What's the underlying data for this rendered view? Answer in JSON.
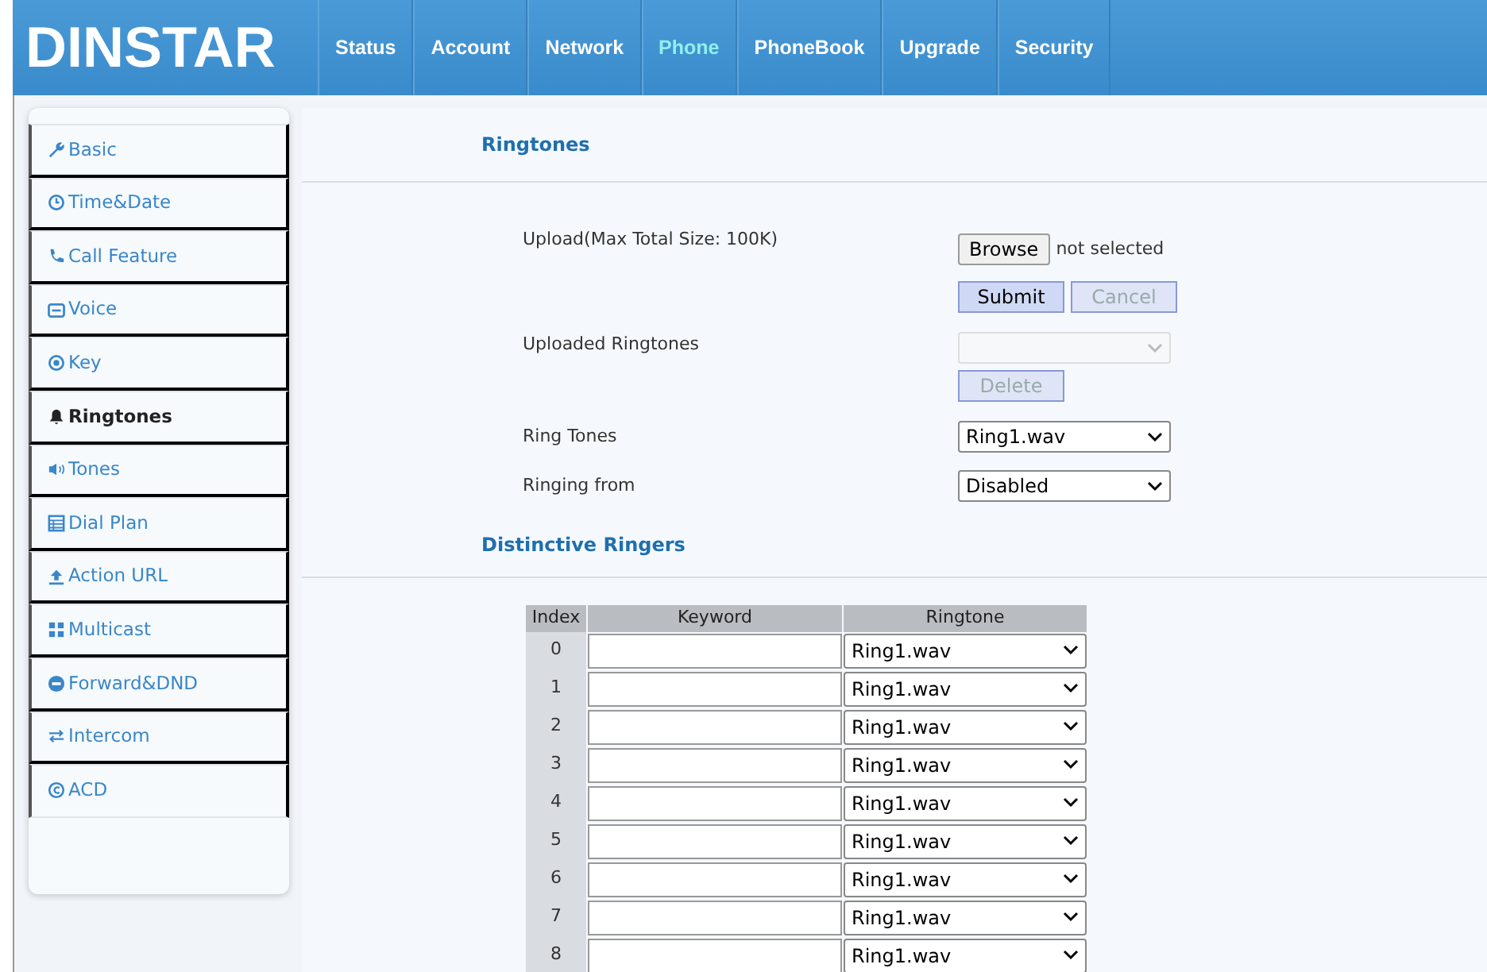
{
  "logo": "DINSTAR",
  "nav": [
    {
      "label": "Status",
      "selected": false
    },
    {
      "label": "Account",
      "selected": false
    },
    {
      "label": "Network",
      "selected": false
    },
    {
      "label": "Phone",
      "selected": true
    },
    {
      "label": "PhoneBook",
      "selected": false
    },
    {
      "label": "Upgrade",
      "selected": false
    },
    {
      "label": "Security",
      "selected": false
    }
  ],
  "sidebar": [
    {
      "label": "Basic",
      "selected": false
    },
    {
      "label": "Time&Date",
      "selected": false
    },
    {
      "label": "Call Feature",
      "selected": false
    },
    {
      "label": "Voice",
      "selected": false
    },
    {
      "label": "Key",
      "selected": false
    },
    {
      "label": "Ringtones",
      "selected": true
    },
    {
      "label": "Tones",
      "selected": false
    },
    {
      "label": "Dial Plan",
      "selected": false
    },
    {
      "label": "Action URL",
      "selected": false
    },
    {
      "label": "Multicast",
      "selected": false
    },
    {
      "label": "Forward&DND",
      "selected": false
    },
    {
      "label": "Intercom",
      "selected": false
    },
    {
      "label": "ACD",
      "selected": false
    }
  ],
  "ringtones": {
    "title": "Ringtones",
    "upload": {
      "label": "Upload(Max Total Size: 100K)",
      "browse": "Browse",
      "file_status": "not selected",
      "buttons": [
        {
          "label": "Submit",
          "disabled": false
        },
        {
          "label": "Cancel",
          "disabled": true
        }
      ]
    },
    "uploaded": {
      "label": "Uploaded Ringtones",
      "disabled": true,
      "button": {
        "label": "Delete",
        "disabled": true
      }
    },
    "ring_tones": {
      "label": "Ring Tones",
      "value": "Ring1.wav"
    },
    "ringing_from": {
      "label": "Ringing from",
      "value": "Disabled"
    }
  },
  "distinctive": {
    "title": "Distinctive Ringers",
    "columns": [
      "Index",
      "Keyword",
      "Ringtone"
    ],
    "rows": [
      {
        "index": "0",
        "ringtone": "Ring1.wav"
      },
      {
        "index": "1",
        "ringtone": "Ring1.wav"
      },
      {
        "index": "2",
        "ringtone": "Ring1.wav"
      },
      {
        "index": "3",
        "ringtone": "Ring1.wav"
      },
      {
        "index": "4",
        "ringtone": "Ring1.wav"
      },
      {
        "index": "5",
        "ringtone": "Ring1.wav"
      },
      {
        "index": "6",
        "ringtone": "Ring1.wav"
      },
      {
        "index": "7",
        "ringtone": "Ring1.wav"
      },
      {
        "index": "8",
        "ringtone": "Ring1.wav"
      }
    ]
  }
}
